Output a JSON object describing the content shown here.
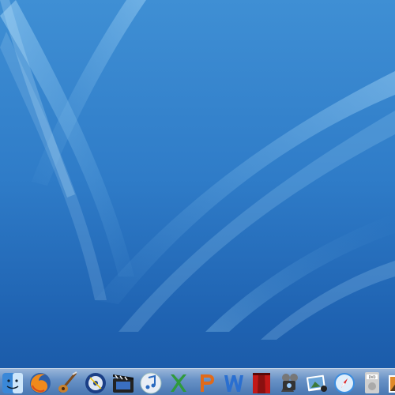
{
  "desktop": {
    "wallpaper": "aqua-blue-swoosh",
    "colors": {
      "wallpaper_top": "#3f8fd4",
      "wallpaper_bottom": "#1a58a6",
      "swoosh": "#7fc0ee"
    }
  },
  "dock": {
    "items": [
      {
        "icon": "finder-icon"
      },
      {
        "icon": "firefox-icon"
      },
      {
        "icon": "garageband-icon"
      },
      {
        "icon": "dvd-studio-icon"
      },
      {
        "icon": "final-cut-icon"
      },
      {
        "icon": "itunes-icon"
      },
      {
        "icon": "excel-icon"
      },
      {
        "icon": "powerpoint-icon"
      },
      {
        "icon": "word-icon"
      },
      {
        "icon": "front-row-icon"
      },
      {
        "icon": "imovie-icon"
      },
      {
        "icon": "iphoto-icon"
      },
      {
        "icon": "safari-icon"
      },
      {
        "icon": "dvd-player-icon"
      },
      {
        "icon": "preview-icon"
      },
      {
        "icon": "system-icon"
      }
    ]
  }
}
